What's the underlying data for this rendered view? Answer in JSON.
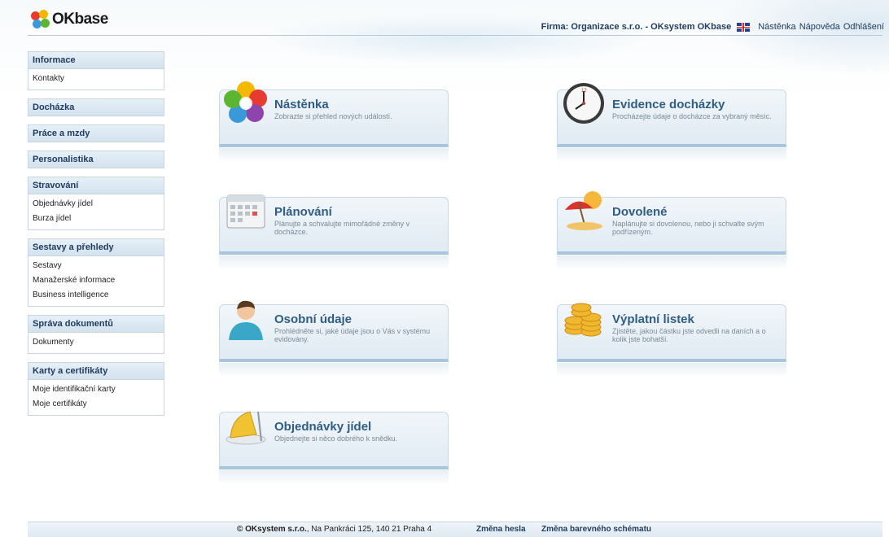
{
  "header": {
    "logo_text": "OKbase",
    "company_label": "Firma: Organizace s.r.o. - OKsystem OKbase",
    "flag_icon": "uk-flag-icon",
    "links": [
      "Nástěnka",
      "Nápověda",
      "Odhlášení"
    ]
  },
  "sidebar": {
    "sections": [
      {
        "title": "Informace",
        "items": [
          "Kontakty"
        ]
      },
      {
        "title": "Docházka",
        "items": []
      },
      {
        "title": "Práce a mzdy",
        "items": []
      },
      {
        "title": "Personalistika",
        "items": []
      },
      {
        "title": "Stravování",
        "items": [
          "Objednávky jídel",
          "Burza jídel"
        ]
      },
      {
        "title": "Sestavy a přehledy",
        "items": [
          "Sestavy",
          "Manažerské informace",
          "Business intelligence"
        ]
      },
      {
        "title": "Správa dokumentů",
        "items": [
          "Dokumenty"
        ]
      },
      {
        "title": "Karty a certifikáty",
        "items": [
          "Moje identifikační karty",
          "Moje certifikáty"
        ]
      }
    ]
  },
  "tiles": [
    {
      "title": "Nástěnka",
      "desc": "Zobrazte si přehled nových událostí.",
      "icon": "flower-icon"
    },
    {
      "title": "Evidence docházky",
      "desc": "Procházejte údaje o docházce za vybraný měsíc.",
      "icon": "clock-icon"
    },
    {
      "title": "Plánování",
      "desc": "Plánujte a schvalujte mimořádné změny v docházce.",
      "icon": "calendar-icon"
    },
    {
      "title": "Dovolené",
      "desc": "Naplánujte si dovolenou, nebo ji schvalte svým podřízeným.",
      "icon": "beach-umbrella-icon"
    },
    {
      "title": "Osobní údaje",
      "desc": "Prohlédněte si, jaké údaje jsou o Vás v systému evidovány.",
      "icon": "person-icon"
    },
    {
      "title": "Výplatní listek",
      "desc": "Zjistěte, jakou částku jste odvedli na daních a o kolik jste bohatší.",
      "icon": "coins-icon"
    },
    {
      "title": "Objednávky jídel",
      "desc": "Objednejte si něco dobrého k snědku.",
      "icon": "food-plate-icon"
    }
  ],
  "footer": {
    "company": "© OKsystem s.r.o.",
    "address": ", Na Pankráci 125, 140 21 Praha 4",
    "change_password": "Změna hesla",
    "change_scheme": "Změna barevného schématu"
  },
  "colors": {
    "accent": "#2f5d86",
    "nav_text": "#1e3a5f",
    "tile_border": "#a7c6dc"
  }
}
